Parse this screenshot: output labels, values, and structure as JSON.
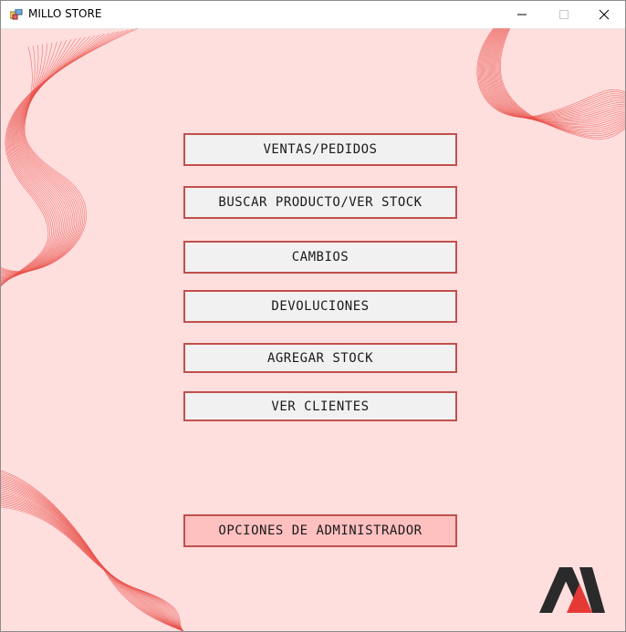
{
  "window": {
    "title": "MILLO STORE",
    "icon": "app-window-icon",
    "controls": [
      "minimize-icon",
      "maximize-icon",
      "close-icon"
    ]
  },
  "menu": {
    "buttons": [
      "VENTAS/PEDIDOS",
      "BUSCAR PRODUCTO/VER STOCK",
      "CAMBIOS",
      "DEVOLUCIONES",
      "AGREGAR STOCK",
      "VER CLIENTES"
    ],
    "admin_button": "OPCIONES DE ADMINISTRADOR"
  },
  "colors": {
    "background": "#ffdede",
    "button_border": "#c0504d",
    "button_bg": "#f1f1f1",
    "admin_bg": "#ffc0c0",
    "wave": "#e8504a",
    "logo_dark": "#2a2a2a",
    "logo_red": "#e53935"
  },
  "logo": {
    "name": "store-logo-icon"
  }
}
